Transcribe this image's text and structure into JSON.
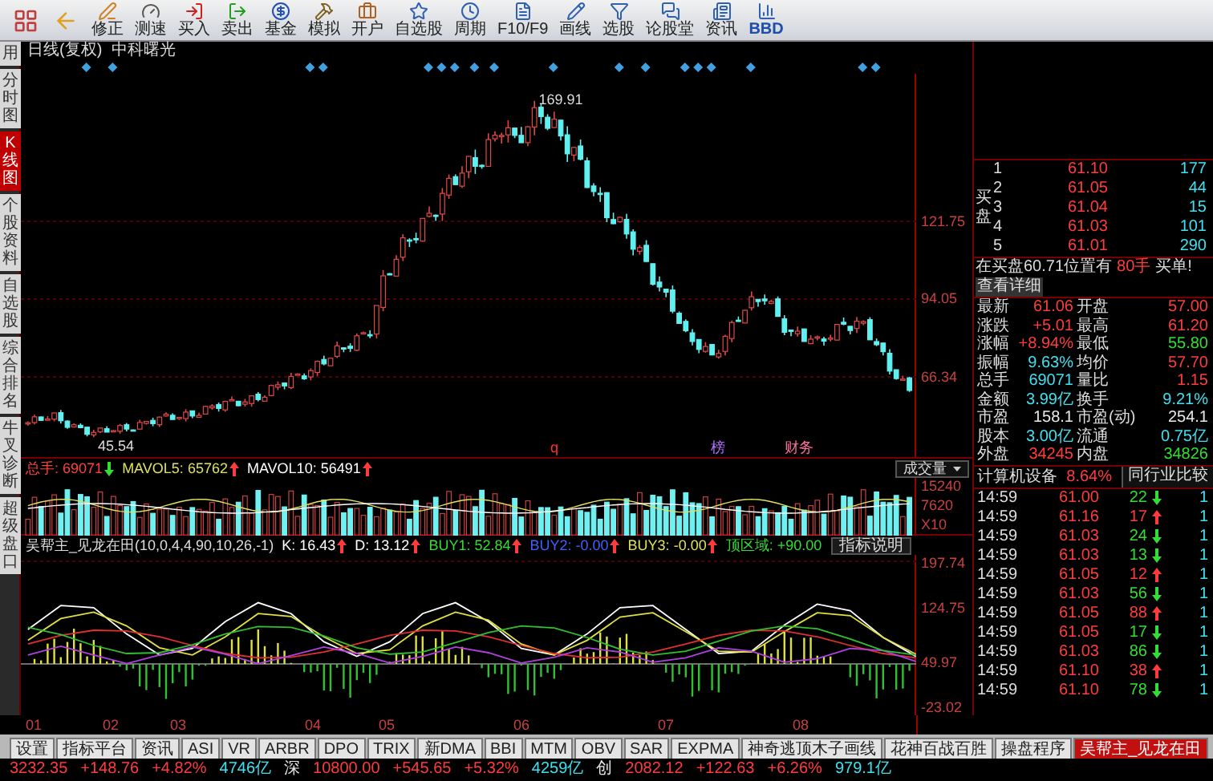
{
  "toolbar": {
    "buttons": [
      {
        "label": "修正"
      },
      {
        "label": "测速"
      },
      {
        "label": "买入"
      },
      {
        "label": "卖出"
      },
      {
        "label": "基金"
      },
      {
        "label": "模拟"
      },
      {
        "label": "开户"
      },
      {
        "label": "自选股"
      },
      {
        "label": "周期"
      },
      {
        "label": "F10/F9"
      },
      {
        "label": "画线"
      },
      {
        "label": "选股"
      },
      {
        "label": "论股堂"
      },
      {
        "label": "资讯"
      },
      {
        "label": "BBD"
      }
    ]
  },
  "side_tabs": [
    {
      "label": "用",
      "selected": false
    },
    {
      "label": "分时图",
      "selected": false
    },
    {
      "label": "K线图",
      "selected": true
    },
    {
      "label": "个股资料",
      "selected": false
    },
    {
      "label": "自选股",
      "selected": false
    },
    {
      "label": "综合排名",
      "selected": false
    },
    {
      "label": "牛叉诊断",
      "selected": false
    },
    {
      "label": "超级盘口",
      "selected": false
    }
  ],
  "chart": {
    "period": "日线(复权)",
    "stock": "中科曙光",
    "high_label": "169.91",
    "low_label": "45.54",
    "price_ticks": [
      "121.75",
      "94.05",
      "66.34"
    ],
    "events": [
      {
        "label": "q",
        "color": "#ff3030"
      },
      {
        "label": "榜",
        "color": "#b070ff"
      },
      {
        "label": "财务",
        "color": "#ff70a0"
      }
    ]
  },
  "volume": {
    "items": [
      {
        "label": "总手:",
        "value": "69071",
        "rising": false,
        "color": "#ff4040"
      },
      {
        "label": "MAVOL5:",
        "value": "65762",
        "rising": true,
        "color": "#e0e060"
      },
      {
        "label": "MAVOL10:",
        "value": "56491",
        "rising": true,
        "color": "#ffffff"
      }
    ],
    "selector": "成交量",
    "ticks": [
      "15240",
      "7620",
      "X10"
    ]
  },
  "indicator": {
    "name": "吴帮主_见龙在田(10,0,4,4,90,10,26,-1)",
    "items": [
      {
        "label": "K:",
        "value": "16.43",
        "rising": true,
        "color": "#ffffff"
      },
      {
        "label": "D:",
        "value": "13.12",
        "rising": true,
        "color": "#ffffff"
      },
      {
        "label": "BUY1:",
        "value": "52.84",
        "rising": true,
        "color": "#33dd33"
      },
      {
        "label": "BUY2:",
        "value": "-0.00",
        "rising": true,
        "color": "#4060ff"
      },
      {
        "label": "BUY3:",
        "value": "-0.00",
        "rising": true,
        "color": "#e0e060"
      },
      {
        "label": "顶区域:",
        "value": "+90.00",
        "color": "#33dd33"
      }
    ],
    "help": "指标说明",
    "chart_data": {
      "type": "line",
      "yticks": [
        197.74,
        124.75,
        49.97,
        -23.02
      ],
      "ylim": [
        -23.02,
        197.74
      ],
      "series": [
        {
          "color": "#ffffff",
          "values": [
            95,
            128,
            125,
            89,
            60,
            69,
            106,
            132,
            117,
            78,
            58,
            78,
            117,
            132,
            106,
            69,
            60,
            89,
            125,
            128,
            95,
            62,
            65,
            101,
            130,
            121,
            84,
            58
          ]
        },
        {
          "color": "#e0e040",
          "values": [
            80,
            110,
            119,
            100,
            70,
            60,
            85,
            117,
            113,
            85,
            62,
            67,
            100,
            119,
            108,
            75,
            60,
            80,
            112,
            118,
            92,
            65,
            64,
            92,
            118,
            114,
            84,
            61
          ]
        },
        {
          "color": "#e03030",
          "values": [
            75,
            87,
            94,
            93,
            85,
            73,
            62,
            56,
            57,
            64,
            75,
            87,
            94,
            93,
            85,
            73,
            62,
            56,
            57,
            64,
            75,
            87,
            94,
            93,
            85,
            73,
            62,
            56
          ]
        },
        {
          "color": "#b040e0",
          "values": [
            60,
            72,
            60,
            48,
            60,
            71,
            61,
            48,
            59,
            71,
            62,
            49,
            58,
            71,
            63,
            49,
            57,
            70,
            64,
            50,
            56,
            70,
            65,
            50,
            55,
            69,
            66,
            51
          ]
        },
        {
          "color": "#30c030",
          "values": [
            98,
            88,
            73,
            62,
            63,
            74,
            89,
            99,
            98,
            86,
            70,
            61,
            64,
            77,
            91,
            100,
            97,
            84,
            68,
            60,
            65,
            79,
            93,
            100,
            96,
            82,
            66,
            60
          ]
        }
      ]
    }
  },
  "dates": [
    "01",
    "02",
    "03",
    "04",
    "05",
    "06",
    "07",
    "08"
  ],
  "bottom_tabs": [
    {
      "label": "设置",
      "selected": false
    },
    {
      "label": "指标平台",
      "selected": false
    },
    {
      "label": "资讯",
      "selected": false
    },
    {
      "label": "ASI",
      "selected": false
    },
    {
      "label": "VR",
      "selected": false
    },
    {
      "label": "ARBR",
      "selected": false
    },
    {
      "label": "DPO",
      "selected": false
    },
    {
      "label": "TRIX",
      "selected": false
    },
    {
      "label": "新DMA",
      "selected": false
    },
    {
      "label": "BBI",
      "selected": false
    },
    {
      "label": "MTM",
      "selected": false
    },
    {
      "label": "OBV",
      "selected": false
    },
    {
      "label": "SAR",
      "selected": false
    },
    {
      "label": "EXPMA",
      "selected": false
    },
    {
      "label": "神奇逃顶木子画线",
      "selected": false
    },
    {
      "label": "花神百战百胜",
      "selected": false
    },
    {
      "label": "操盘程序",
      "selected": false
    },
    {
      "label": "吴帮主_见龙在田",
      "selected": true
    }
  ],
  "status_bar": [
    {
      "text": "3232.35",
      "color": "#ff3c3c"
    },
    {
      "text": "+148.76",
      "color": "#ff3c3c"
    },
    {
      "text": "+4.82%",
      "color": "#ff3c3c"
    },
    {
      "text": "4746亿",
      "color": "#40e0f0"
    },
    {
      "text": "深",
      "color": "#e8e8e8"
    },
    {
      "text": "10800.00",
      "color": "#ff3c3c"
    },
    {
      "text": "+545.65",
      "color": "#ff3c3c"
    },
    {
      "text": "+5.32%",
      "color": "#ff3c3c"
    },
    {
      "text": "4259亿",
      "color": "#40e0f0"
    },
    {
      "text": "创",
      "color": "#e8e8e8"
    },
    {
      "text": "2082.12",
      "color": "#ff3c3c"
    },
    {
      "text": "+122.63",
      "color": "#ff3c3c"
    },
    {
      "text": "+6.26%",
      "color": "#ff3c3c"
    },
    {
      "text": "979.1亿",
      "color": "#40e0f0"
    }
  ],
  "quote": {
    "book_label": "买盘",
    "book": [
      {
        "rank": "1",
        "price": "61.10",
        "volume": "177"
      },
      {
        "rank": "2",
        "price": "61.05",
        "volume": "44"
      },
      {
        "rank": "3",
        "price": "61.04",
        "volume": "15"
      },
      {
        "rank": "4",
        "price": "61.03",
        "volume": "101"
      },
      {
        "rank": "5",
        "price": "61.01",
        "volume": "290"
      }
    ],
    "notice": {
      "text": "在买盘60.71位置有",
      "amount": "80手",
      "type": "买单!",
      "link": "查看详细"
    },
    "stats": [
      {
        "label": "最新",
        "value": "61.06",
        "color": "#ff3c3c"
      },
      {
        "label": "开盘",
        "value": "57.00",
        "color": "#ff3c3c"
      },
      {
        "label": "涨跌",
        "value": "+5.01",
        "color": "#ff3c3c"
      },
      {
        "label": "最高",
        "value": "61.20",
        "color": "#ff3c3c"
      },
      {
        "label": "涨幅",
        "value": "+8.94%",
        "color": "#ff3c3c"
      },
      {
        "label": "最低",
        "value": "55.80",
        "color": "#33dd33"
      },
      {
        "label": "振幅",
        "value": "9.63%",
        "color": "#40e0f0"
      },
      {
        "label": "均价",
        "value": "57.70",
        "color": "#ff3c3c"
      },
      {
        "label": "总手",
        "value": "69071",
        "color": "#40e0f0"
      },
      {
        "label": "量比",
        "value": "1.15",
        "color": "#ff3c3c"
      },
      {
        "label": "金额",
        "value": "3.99亿",
        "color": "#40e0f0"
      },
      {
        "label": "换手",
        "value": "9.21%",
        "color": "#40e0f0"
      },
      {
        "label": "市盈",
        "value": "158.1",
        "color": "#e8e8e8"
      },
      {
        "label": "市盈(动)",
        "value": "254.1",
        "color": "#e8e8e8"
      },
      {
        "label": "股本",
        "value": "3.00亿",
        "color": "#40e0f0"
      },
      {
        "label": "流通",
        "value": "0.75亿",
        "color": "#40e0f0"
      },
      {
        "label": "外盘",
        "value": "34245",
        "color": "#ff3c3c"
      },
      {
        "label": "内盘",
        "value": "34826",
        "color": "#33dd33"
      }
    ],
    "sector": {
      "name": "计算机设备",
      "change": "8.64%",
      "compare": "同行业比较"
    },
    "ticks": [
      {
        "time": "14:59",
        "price": "61.00",
        "volume": "22",
        "rising": false,
        "extra": "1"
      },
      {
        "time": "14:59",
        "price": "61.16",
        "volume": "17",
        "rising": true,
        "extra": "1"
      },
      {
        "time": "14:59",
        "price": "61.03",
        "volume": "24",
        "rising": false,
        "extra": "1"
      },
      {
        "time": "14:59",
        "price": "61.03",
        "volume": "13",
        "rising": false,
        "extra": "1"
      },
      {
        "time": "14:59",
        "price": "61.05",
        "volume": "12",
        "rising": true,
        "extra": "1"
      },
      {
        "time": "14:59",
        "price": "61.03",
        "volume": "56",
        "rising": false,
        "extra": "1"
      },
      {
        "time": "14:59",
        "price": "61.05",
        "volume": "88",
        "rising": true,
        "extra": "1"
      },
      {
        "time": "14:59",
        "price": "61.05",
        "volume": "17",
        "rising": false,
        "extra": "1"
      },
      {
        "time": "14:59",
        "price": "61.03",
        "volume": "86",
        "rising": false,
        "extra": "1"
      },
      {
        "time": "14:59",
        "price": "61.10",
        "volume": "38",
        "rising": true,
        "extra": "1"
      },
      {
        "time": "14:59",
        "price": "61.10",
        "volume": "78",
        "rising": false,
        "extra": "1"
      }
    ]
  }
}
